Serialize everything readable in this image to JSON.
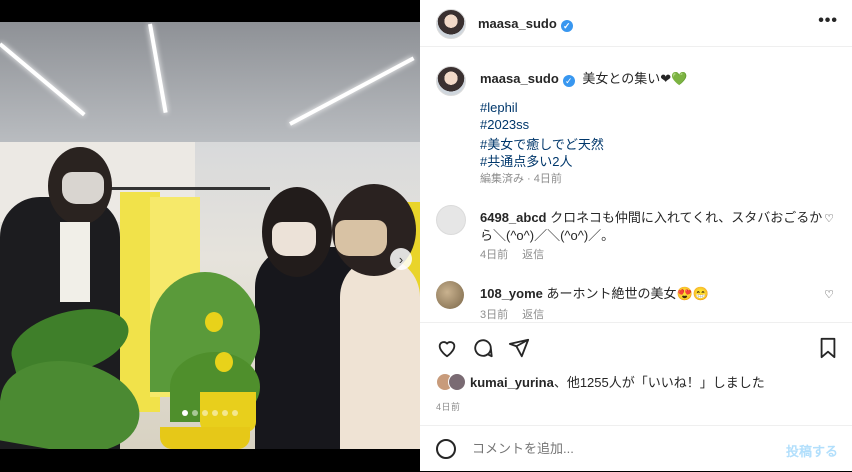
{
  "post": {
    "username": "maasa_sudo",
    "more_label": "•••"
  },
  "caption": {
    "username": "maasa_sudo",
    "text": "美女との集い❤︎💚",
    "hashtags": [
      "#lephil",
      "#2023ss",
      "#美女で癒しでど天然",
      "#共通点多い2人"
    ],
    "edited": "編集済み · 4日前"
  },
  "comments": [
    {
      "username": "6498_abcd",
      "text": "クロネコも仲間に入れてくれ、スタバおごるから＼(^o^)／＼(^o^)／。",
      "time": "4日前",
      "reply": "返信"
    },
    {
      "username": "108_yome",
      "text": "あーホント絶世の美女😍😁",
      "time": "3日前",
      "reply": "返信"
    }
  ],
  "likes": {
    "user": "kumai_yurina",
    "text": "、他1255人が「いいね！」しました"
  },
  "date": "4日前",
  "comment_box": {
    "placeholder": "コメントを追加...",
    "post_label": "投稿する"
  },
  "carousel": {
    "slides": 6,
    "active": 1
  },
  "colors": {
    "link": "#00376b",
    "verified": "#3897f0",
    "post_disabled": "#b2dffc"
  }
}
